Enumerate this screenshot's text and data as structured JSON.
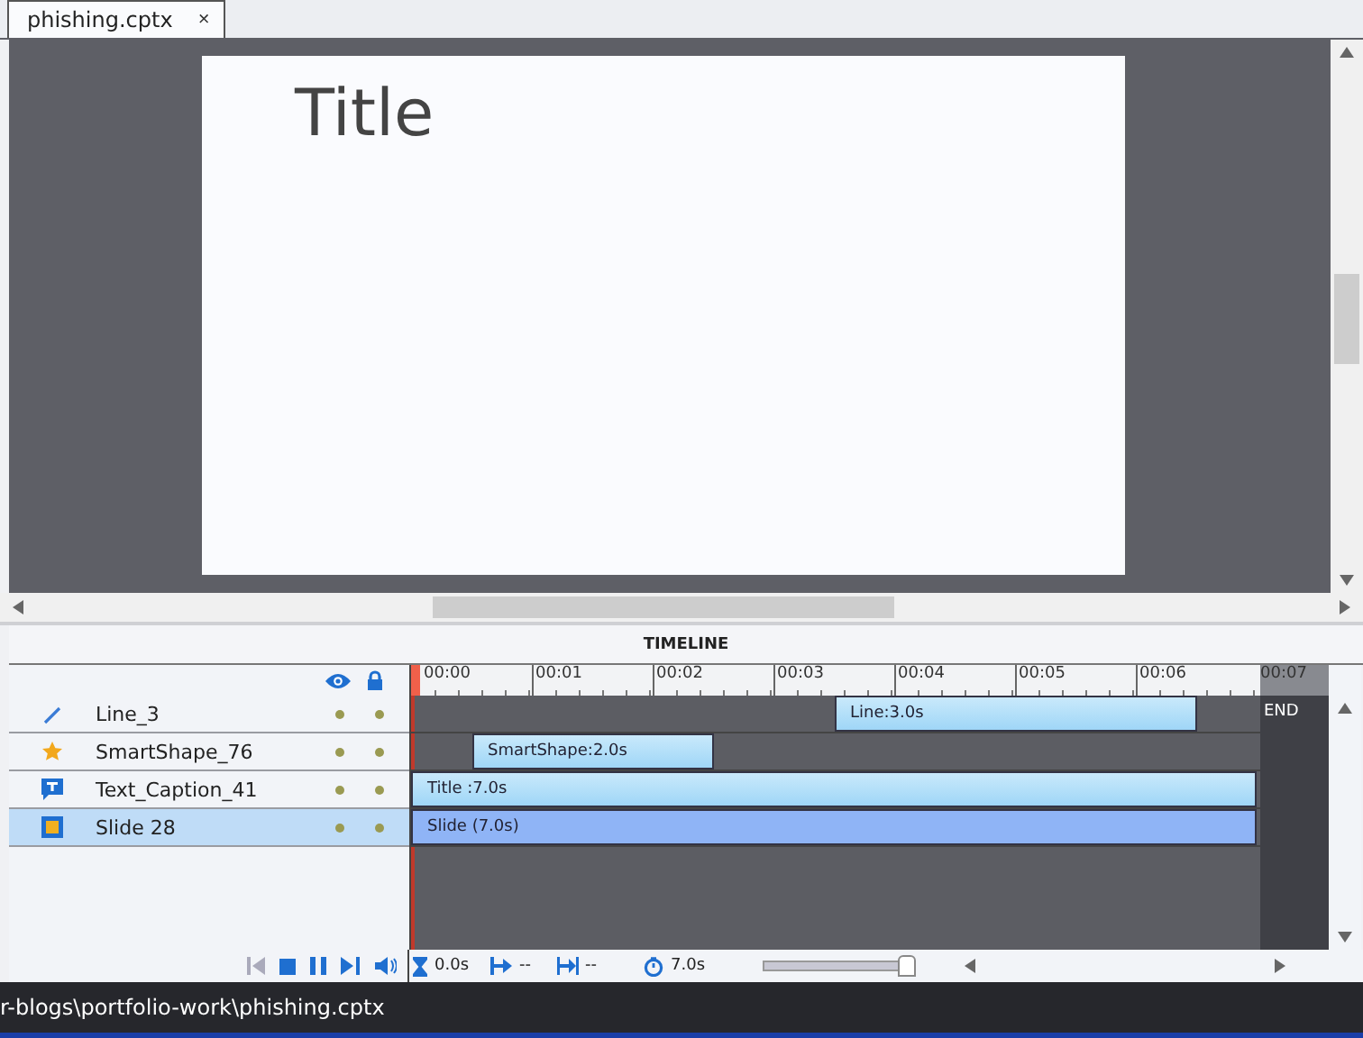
{
  "tab": {
    "label": "phishing.cptx",
    "close": "×"
  },
  "slide": {
    "title": "Title"
  },
  "timeline": {
    "heading": "TIMELINE",
    "ticks": [
      "00:00",
      "00:01",
      "00:02",
      "00:03",
      "00:04",
      "00:05",
      "00:06",
      "00:07"
    ],
    "end_label": "END",
    "layers": [
      {
        "kind": "line",
        "name": "Line_3",
        "bar": "Line:3.0s",
        "selected": false
      },
      {
        "kind": "shape",
        "name": "SmartShape_76",
        "bar": "SmartShape:2.0s",
        "selected": false
      },
      {
        "kind": "caption",
        "name": "Text_Caption_41",
        "bar": "Title :7.0s",
        "selected": false
      },
      {
        "kind": "slide",
        "name": "Slide 28",
        "bar": "Slide (7.0s)",
        "selected": true
      }
    ],
    "playback": {
      "current": "0.0s",
      "start": "--",
      "end": "--",
      "duration": "7.0s"
    },
    "zoom_slider": {
      "level": 0.95
    }
  },
  "status_bar": {
    "path": "r-blogs\\portfolio-work\\phishing.cptx"
  }
}
